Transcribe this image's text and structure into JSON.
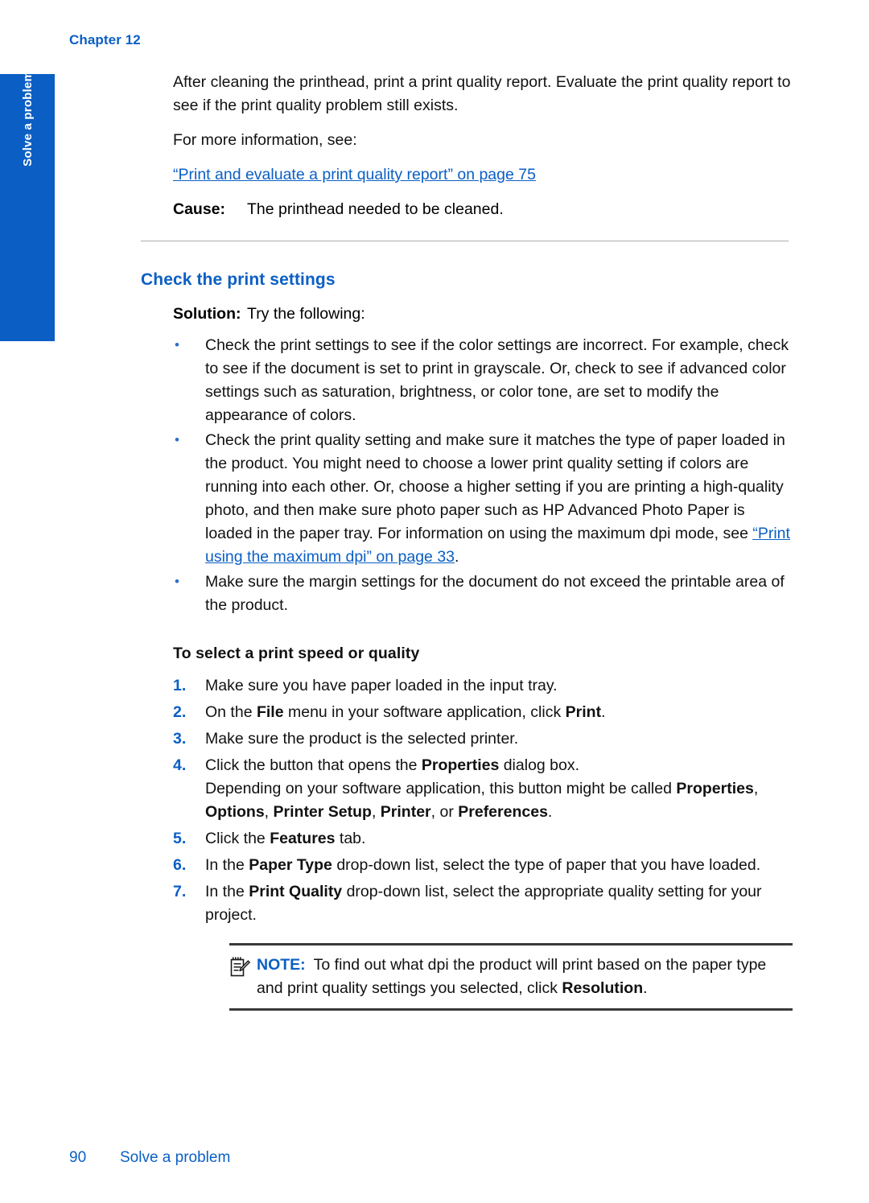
{
  "page": {
    "chapter_label": "Chapter 12",
    "side_tab_label": "Solve a problem",
    "accent_blue": "#0B5FC4",
    "rule_gray": "#adadad"
  },
  "intro": {
    "paragraph_1": "After cleaning the printhead, print a print quality report. Evaluate the print quality report to see if the print quality problem still exists.",
    "paragraph_2": "For more information, see:",
    "link_quoted": "“Print and evaluate a print quality report”",
    "link_page_suffix": " on page 75",
    "cause_term": "Cause:",
    "cause_desc": "The printhead needed to be cleaned."
  },
  "section": {
    "heading": "Check the print settings",
    "solution_term": "Solution:",
    "solution_desc": "Try the following:",
    "bullets": [
      {
        "text": "Check the print settings to see if the color settings are incorrect.",
        "sub": "For example, check to see if the document is set to print in grayscale. Or, check to see if advanced color settings such as saturation, brightness, or color tone, are set to modify the appearance of colors."
      },
      {
        "text": "Check the print quality setting and make sure it matches the type of paper loaded in the product.",
        "sub_prefix": "You might need to choose a lower print quality setting if colors are running into each other. Or, choose a higher setting if you are printing a high-quality photo, and then make sure photo paper such as HP Advanced Photo Paper is loaded in the paper tray. For information on using the maximum dpi mode, see ",
        "sub_link_quoted": "“Print using the maximum dpi”",
        "sub_link_page": " on page 33",
        "sub_suffix": "."
      },
      {
        "text": "Make sure the margin settings for the document do not exceed the printable area of the product."
      }
    ]
  },
  "procedure": {
    "heading": "To select a print speed or quality",
    "steps": [
      {
        "num": "1.",
        "parts": [
          {
            "t": "Make sure you have paper loaded in the input tray.",
            "b": false
          }
        ]
      },
      {
        "num": "2.",
        "parts": [
          {
            "t": "On the ",
            "b": false
          },
          {
            "t": "File",
            "b": true
          },
          {
            "t": " menu in your software application, click ",
            "b": false
          },
          {
            "t": "Print",
            "b": true
          },
          {
            "t": ".",
            "b": false
          }
        ]
      },
      {
        "num": "3.",
        "parts": [
          {
            "t": "Make sure the product is the selected printer.",
            "b": false
          }
        ]
      },
      {
        "num": "4.",
        "parts": [
          {
            "t": "Click the button that opens the ",
            "b": false
          },
          {
            "t": "Properties",
            "b": true
          },
          {
            "t": " dialog box.",
            "b": false
          }
        ],
        "continuation": [
          {
            "t": "Depending on your software application, this button might be called ",
            "b": false
          },
          {
            "t": "Properties",
            "b": true
          },
          {
            "t": ", ",
            "b": false
          },
          {
            "t": "Options",
            "b": true
          },
          {
            "t": ", ",
            "b": false
          },
          {
            "t": "Printer Setup",
            "b": true
          },
          {
            "t": ", ",
            "b": false
          },
          {
            "t": "Printer",
            "b": true
          },
          {
            "t": ", or ",
            "b": false
          },
          {
            "t": "Preferences",
            "b": true
          },
          {
            "t": ".",
            "b": false
          }
        ]
      },
      {
        "num": "5.",
        "parts": [
          {
            "t": "Click the ",
            "b": false
          },
          {
            "t": "Features",
            "b": true
          },
          {
            "t": " tab.",
            "b": false
          }
        ]
      },
      {
        "num": "6.",
        "parts": [
          {
            "t": "In the ",
            "b": false
          },
          {
            "t": "Paper Type",
            "b": true
          },
          {
            "t": " drop-down list, select the type of paper that you have loaded.",
            "b": false
          }
        ]
      },
      {
        "num": "7.",
        "parts": [
          {
            "t": "In the ",
            "b": false
          },
          {
            "t": "Print Quality",
            "b": true
          },
          {
            "t": " drop-down list, select the appropriate quality setting for your project.",
            "b": false
          }
        ]
      }
    ]
  },
  "note": {
    "icon": "notepad-pencil-icon",
    "label": "NOTE:",
    "parts": [
      {
        "t": "To find out what dpi the product will print based on the paper type and print quality settings you selected, click ",
        "b": false
      },
      {
        "t": "Resolution",
        "b": true
      },
      {
        "t": ".",
        "b": false
      }
    ]
  },
  "footer": {
    "page_number": "90",
    "title": "Solve a problem"
  }
}
